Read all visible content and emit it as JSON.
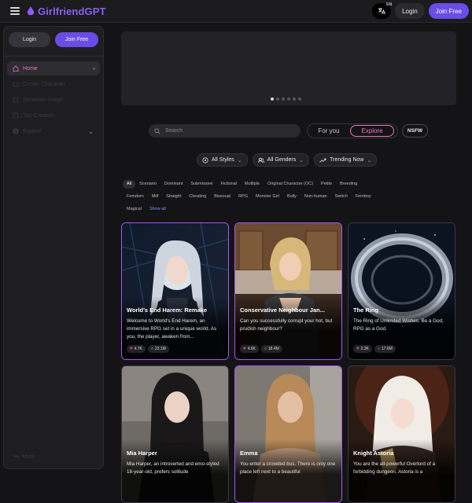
{
  "header": {
    "logo_text": "GirlfriendGPT",
    "lang_badge": "EN",
    "login_label": "Login",
    "join_label": "Join Free"
  },
  "sidebar": {
    "login_label": "Login",
    "join_label": "Join Free",
    "items": [
      {
        "label": "Home",
        "icon": "home-icon"
      },
      {
        "label": "Create Character",
        "icon": "create-character-icon"
      },
      {
        "label": "Generate Image",
        "icon": "image-icon"
      },
      {
        "label": "Top Creators",
        "icon": "creators-icon"
      },
      {
        "label": "Explore",
        "icon": "compass-icon"
      }
    ],
    "more_label": "More"
  },
  "search": {
    "placeholder": "Search"
  },
  "mode_tabs": {
    "for_you": "For you",
    "explore": "Explore",
    "nsfw": "NSFW"
  },
  "filters": {
    "styles": "All Styles",
    "genders": "All Genders",
    "sort": "Trending Now"
  },
  "tags_row1": [
    "All",
    "Scenario",
    "Dominant",
    "Submissive",
    "Fictional",
    "Multiple",
    "Original Character (OC)",
    "Petite",
    "Breeding"
  ],
  "tags_row2": [
    "Femdom",
    "Milf",
    "Straight",
    "Cheating",
    "Bisexual",
    "RPG",
    "Monster Girl",
    "Bully",
    "Non-human",
    "Switch",
    "Femboy"
  ],
  "tags_row3": [
    "Magical",
    "Show all"
  ],
  "cards": [
    {
      "title": "World's End Harem: Remake",
      "desc": "Welcome to World's End Harem, an immersive RPG set in a unique world. As you, the player, awaken from...",
      "likes": "4.7K",
      "chats": "23.1M"
    },
    {
      "title": "Conservative Neighbour Jan...",
      "desc": "Can you successfully corrupt your hot, but prudish neighbour?",
      "likes": "4.6K",
      "chats": "18.4M"
    },
    {
      "title": "The Ring",
      "desc": "The Ring of Unlimited Wishes. Be a God, RPG as a God.",
      "likes": "2.3K",
      "chats": "17.6M"
    },
    {
      "title": "Mia Harper",
      "desc": "Mia Harper, an introverted and emo-styled 18-year-old, prefers solitude",
      "likes": "",
      "chats": ""
    },
    {
      "title": "Emma",
      "desc": "You enter a crowded bus. There is only one place left next to a beautiful",
      "likes": "",
      "chats": ""
    },
    {
      "title": "Knight Astoria",
      "desc": "You are the all-powerful Overlord of a forbidding dungeon. Astoria is a",
      "likes": "",
      "chats": ""
    }
  ],
  "colors": {
    "accent": "#6a4ce6",
    "pink": "#e879c6",
    "bg": "#141416"
  }
}
